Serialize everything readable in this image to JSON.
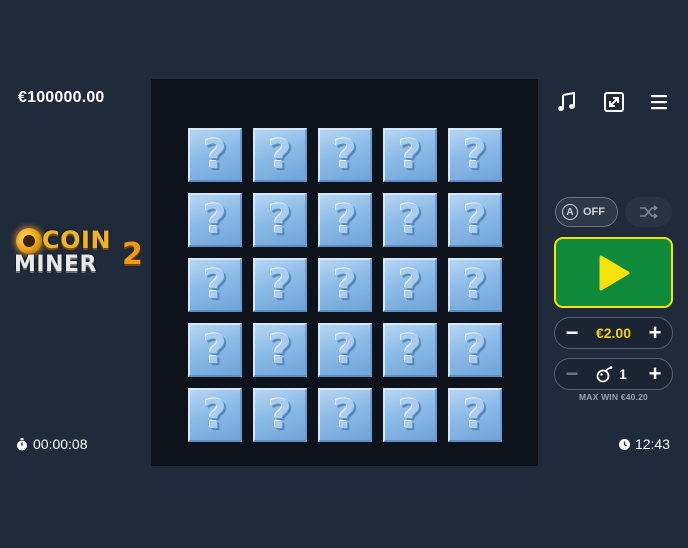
{
  "balance": "€100000.00",
  "logo": {
    "line1": "COIN",
    "line2": "MINER",
    "number": "2"
  },
  "timer": {
    "elapsed": "00:00:08"
  },
  "clock": {
    "time": "12:43"
  },
  "board": {
    "rows": 5,
    "cols": 5,
    "tile_symbol": "?"
  },
  "controls": {
    "auto": {
      "letter": "A",
      "state": "OFF"
    },
    "bet": {
      "value": "€2.00",
      "minus": "−",
      "plus": "+"
    },
    "mines": {
      "value": "1",
      "minus": "−",
      "plus": "+"
    },
    "max_win": "MAX WIN €40.20"
  },
  "icons": {
    "music": "music-note-icon",
    "fullscreen": "fullscreen-icon",
    "menu": "hamburger-menu-icon",
    "shuffle": "shuffle-icon",
    "play": "play-icon",
    "bomb": "bomb-icon",
    "stopwatch": "stopwatch-icon",
    "clock": "clock-icon"
  },
  "colors": {
    "background": "#1f2a3b",
    "board": "#0d121b",
    "tile": "#8cbbe8",
    "play_button": "#0e8a3a",
    "play_border": "#f6e20a",
    "bet_text": "#f4d10c"
  }
}
